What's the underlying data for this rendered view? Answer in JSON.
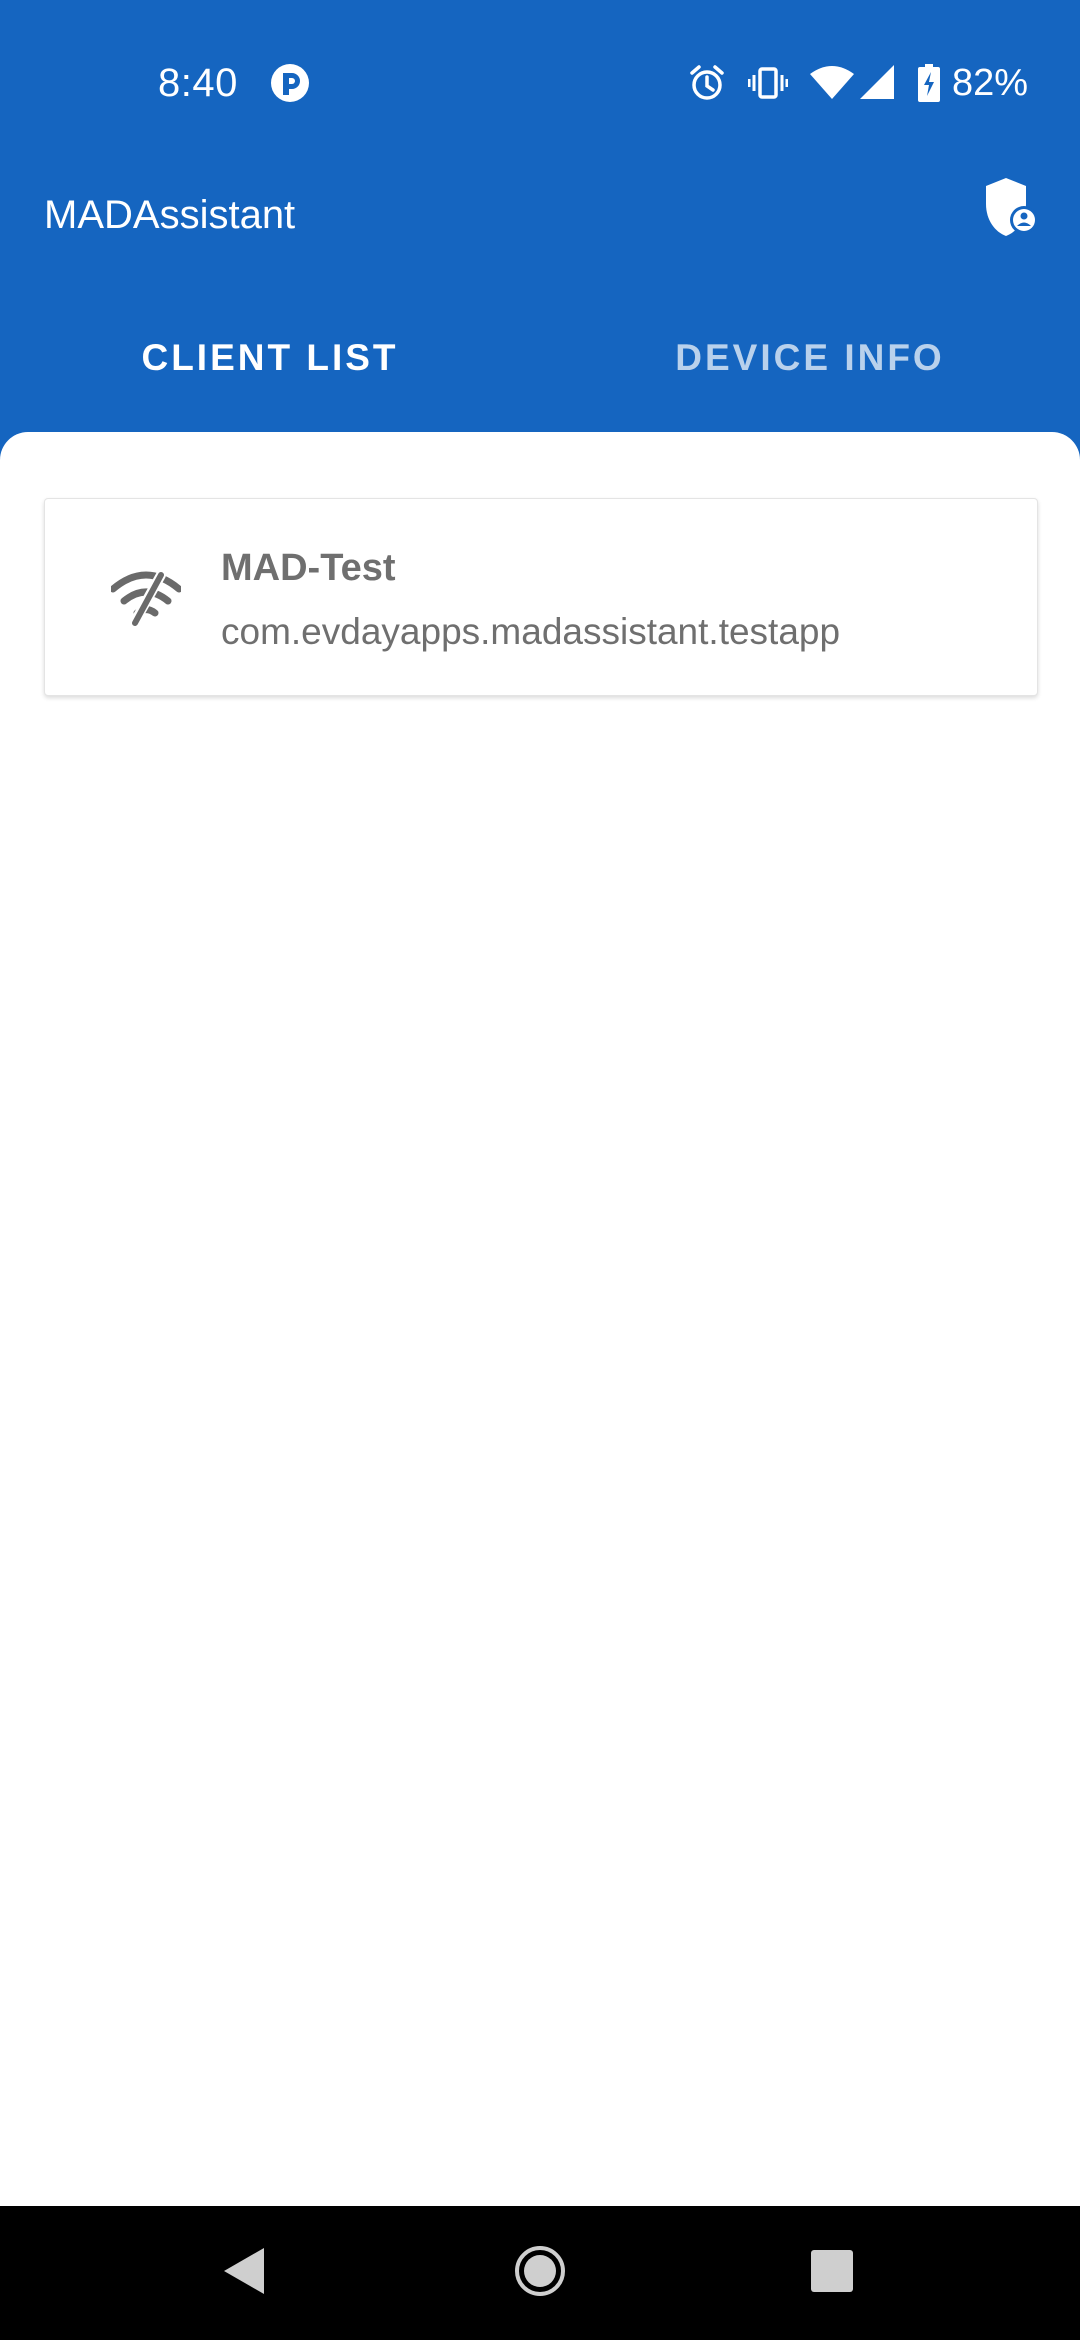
{
  "status_bar": {
    "time": "8:40",
    "battery_percent": "82%",
    "icons": [
      "app-notification-icon",
      "alarm-icon",
      "vibrate-icon",
      "wifi-icon",
      "cell-signal-icon",
      "battery-charging-icon"
    ]
  },
  "app_bar": {
    "title": "MADAssistant",
    "action_icon": "shield-account-icon"
  },
  "tabs": [
    {
      "label": "CLIENT LIST",
      "selected": true
    },
    {
      "label": "DEVICE INFO",
      "selected": false
    }
  ],
  "clients": [
    {
      "name": "MAD-Test",
      "package": "com.evdayapps.madassistant.testapp",
      "icon": "wifi-off-icon"
    }
  ],
  "nav_bar": {
    "buttons": [
      "back-icon",
      "home-icon",
      "recents-icon"
    ]
  },
  "colors": {
    "primary": "#1565C0",
    "surface": "#FFFFFF",
    "secondary_text": "#6F6F6F",
    "nav_bar": "#000000"
  }
}
